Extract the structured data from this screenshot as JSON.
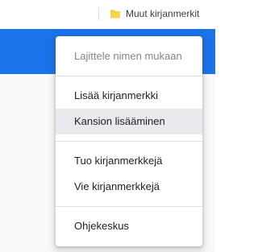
{
  "bookmarks_bar": {
    "other_bookmarks_label": "Muut kirjanmerkit",
    "folder_icon": "folder-icon",
    "folder_color": "#f9c22d"
  },
  "colors": {
    "brand_band": "#1a73e8",
    "menu_hover": "#e8eaed"
  },
  "menu": {
    "sort_label": "Lajittele nimen mukaan",
    "add_bookmark_label": "Lisää kirjanmerkki",
    "add_folder_label": "Kansion lisääminen",
    "import_label": "Tuo kirjanmerkkejä",
    "export_label": "Vie kirjanmerkkejä",
    "help_label": "Ohjekeskus",
    "hovered_item": "Kansion lisääminen"
  }
}
